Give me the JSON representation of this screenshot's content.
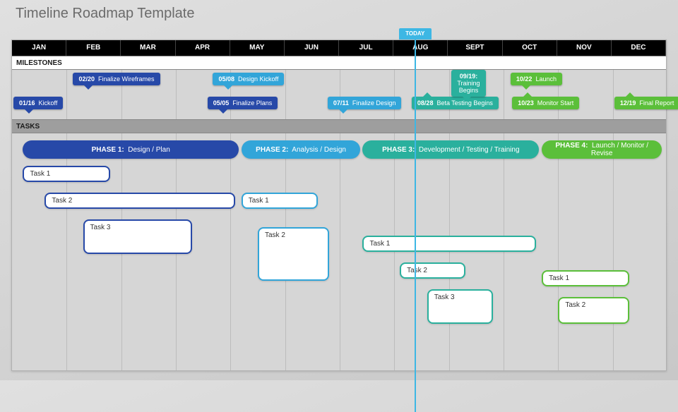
{
  "title": "Timeline Roadmap Template",
  "today_label": "TODAY",
  "section_labels": {
    "milestones": "MILESTONES",
    "tasks": "TASKS"
  },
  "months": [
    "JAN",
    "FEB",
    "MAR",
    "APR",
    "MAY",
    "JUN",
    "JUL",
    "AUG",
    "SEPT",
    "OCT",
    "NOV",
    "DEC"
  ],
  "chart_data": {
    "type": "gantt",
    "title": "Timeline Roadmap Template",
    "x_axis": {
      "unit": "month",
      "start": 1,
      "end": 12
    },
    "today": 8.38,
    "milestones": [
      {
        "date": "01/16",
        "label": "Kickoff",
        "month": 1.53,
        "row": 1,
        "color": "#2749a8",
        "arrow": "down"
      },
      {
        "date": "02/20",
        "label": "Finalize Wireframes",
        "month": 2.7,
        "row": 0,
        "color": "#2749a8",
        "arrow": "down"
      },
      {
        "date": "05/05",
        "label": "Finalize Plans",
        "month": 5.16,
        "row": 1,
        "color": "#2749a8",
        "arrow": "down"
      },
      {
        "date": "05/08",
        "label": "Design Kickoff",
        "month": 5.26,
        "row": 0,
        "color": "#32a5d9",
        "arrow": "down"
      },
      {
        "date": "07/11",
        "label": "Finalize Design",
        "month": 7.36,
        "row": 1,
        "color": "#32a5d9",
        "arrow": "down"
      },
      {
        "date": "08/28",
        "label": "Beta Testing Begins",
        "month": 8.9,
        "row": 1,
        "color": "#2ab09d",
        "arrow": "up"
      },
      {
        "date": "09/19",
        "label": "Training Begins",
        "month": 9.63,
        "row": 0,
        "color": "#2ab09d",
        "arrow": "down",
        "multiline": true
      },
      {
        "date": "10/22",
        "label": "Launch",
        "month": 10.71,
        "row": 0,
        "color": "#5bbf3a",
        "arrow": "down"
      },
      {
        "date": "10/23",
        "label": "Monitor Start",
        "month": 10.74,
        "row": 1,
        "color": "#5bbf3a",
        "arrow": "up"
      },
      {
        "date": "12/19",
        "label": "Final Report",
        "month": 12.61,
        "row": 1,
        "color": "#5bbf3a",
        "arrow": "up"
      }
    ],
    "phases": [
      {
        "name": "PHASE 1:",
        "desc": "Design / Plan",
        "start": 1.2,
        "end": 5.15,
        "color": "#2749a8"
      },
      {
        "name": "PHASE 2:",
        "desc": "Analysis / Design",
        "start": 5.2,
        "end": 7.38,
        "color": "#32a5d9"
      },
      {
        "name": "PHASE 3:",
        "desc": "Development / Testing / Training",
        "start": 7.42,
        "end": 10.65,
        "color": "#2ab09d"
      },
      {
        "name": "PHASE 4:",
        "desc": "Launch / Monitor / Revise",
        "start": 10.7,
        "end": 12.9,
        "color": "#5bbf3a"
      }
    ],
    "tasks": [
      {
        "phase": 1,
        "label": "Task 1",
        "start": 1.2,
        "end": 2.8,
        "row": 0,
        "height": 0.6,
        "color": "#2749a8"
      },
      {
        "phase": 1,
        "label": "Task 2",
        "start": 1.6,
        "end": 5.08,
        "row": 1,
        "height": 0.6,
        "color": "#2749a8"
      },
      {
        "phase": 1,
        "label": "Task 3",
        "start": 2.3,
        "end": 4.3,
        "row": 2,
        "height": 1.3,
        "color": "#2749a8"
      },
      {
        "phase": 2,
        "label": "Task 1",
        "start": 5.2,
        "end": 6.6,
        "row": 1,
        "height": 0.6,
        "color": "#32a5d9"
      },
      {
        "phase": 2,
        "label": "Task 2",
        "start": 5.5,
        "end": 6.8,
        "row": 2.3,
        "height": 2.0,
        "color": "#32a5d9"
      },
      {
        "phase": 3,
        "label": "Task 1",
        "start": 7.42,
        "end": 10.6,
        "row": 2.6,
        "height": 0.6,
        "color": "#2ab09d"
      },
      {
        "phase": 3,
        "label": "Task 2",
        "start": 8.1,
        "end": 9.3,
        "row": 3.6,
        "height": 0.6,
        "color": "#2ab09d"
      },
      {
        "phase": 3,
        "label": "Task 3",
        "start": 8.6,
        "end": 9.8,
        "row": 4.6,
        "height": 1.3,
        "color": "#2ab09d"
      },
      {
        "phase": 4,
        "label": "Task 1",
        "start": 10.7,
        "end": 12.3,
        "row": 3.9,
        "height": 0.6,
        "color": "#5bbf3a"
      },
      {
        "phase": 4,
        "label": "Task 2",
        "start": 11.0,
        "end": 12.3,
        "row": 4.9,
        "height": 1.0,
        "color": "#5bbf3a"
      }
    ]
  }
}
